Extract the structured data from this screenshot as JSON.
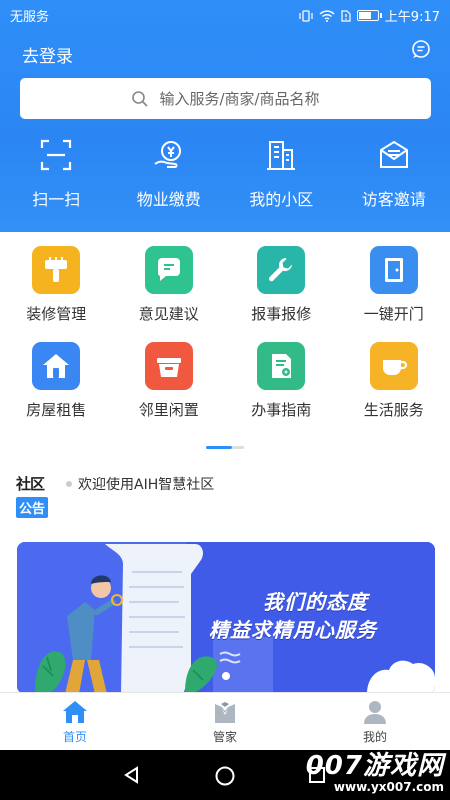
{
  "status_bar": {
    "carrier": "无服务",
    "time": "上午9:17"
  },
  "header": {
    "login_label": "去登录",
    "search_placeholder": "输入服务/商家/商品名称"
  },
  "quick_actions": [
    {
      "label": "扫一扫",
      "icon": "scan-icon"
    },
    {
      "label": "物业缴费",
      "icon": "payment-icon"
    },
    {
      "label": "我的小区",
      "icon": "community-icon"
    },
    {
      "label": "访客邀请",
      "icon": "mail-icon"
    }
  ],
  "services": [
    {
      "label": "装修管理",
      "icon": "brush-icon",
      "color": "#f5b41f"
    },
    {
      "label": "意见建议",
      "icon": "message-icon",
      "color": "#2fc38f"
    },
    {
      "label": "报事报修",
      "icon": "wrench-icon",
      "color": "#27b6a8"
    },
    {
      "label": "一键开门",
      "icon": "door-icon",
      "color": "#3a8ef0"
    },
    {
      "label": "房屋租售",
      "icon": "house-icon",
      "color": "#3a86f3"
    },
    {
      "label": "邻里闲置",
      "icon": "basket-icon",
      "color": "#f0583f"
    },
    {
      "label": "办事指南",
      "icon": "guide-icon",
      "color": "#32bb86"
    },
    {
      "label": "生活服务",
      "icon": "cup-icon",
      "color": "#f6b325"
    }
  ],
  "notice": {
    "logo_top": "社区",
    "logo_bottom": "公告",
    "text": "欢迎使用AIH智慧社区"
  },
  "banner": {
    "line1": "我们的态度",
    "line2": "精益求精用心服务"
  },
  "tabbar": [
    {
      "label": "首页",
      "icon": "home-icon",
      "active": true
    },
    {
      "label": "管家",
      "icon": "butler-icon",
      "active": false
    },
    {
      "label": "我的",
      "icon": "profile-icon",
      "active": false
    }
  ],
  "watermark": {
    "brand": "007游戏网",
    "url": "www.yx007.com"
  }
}
